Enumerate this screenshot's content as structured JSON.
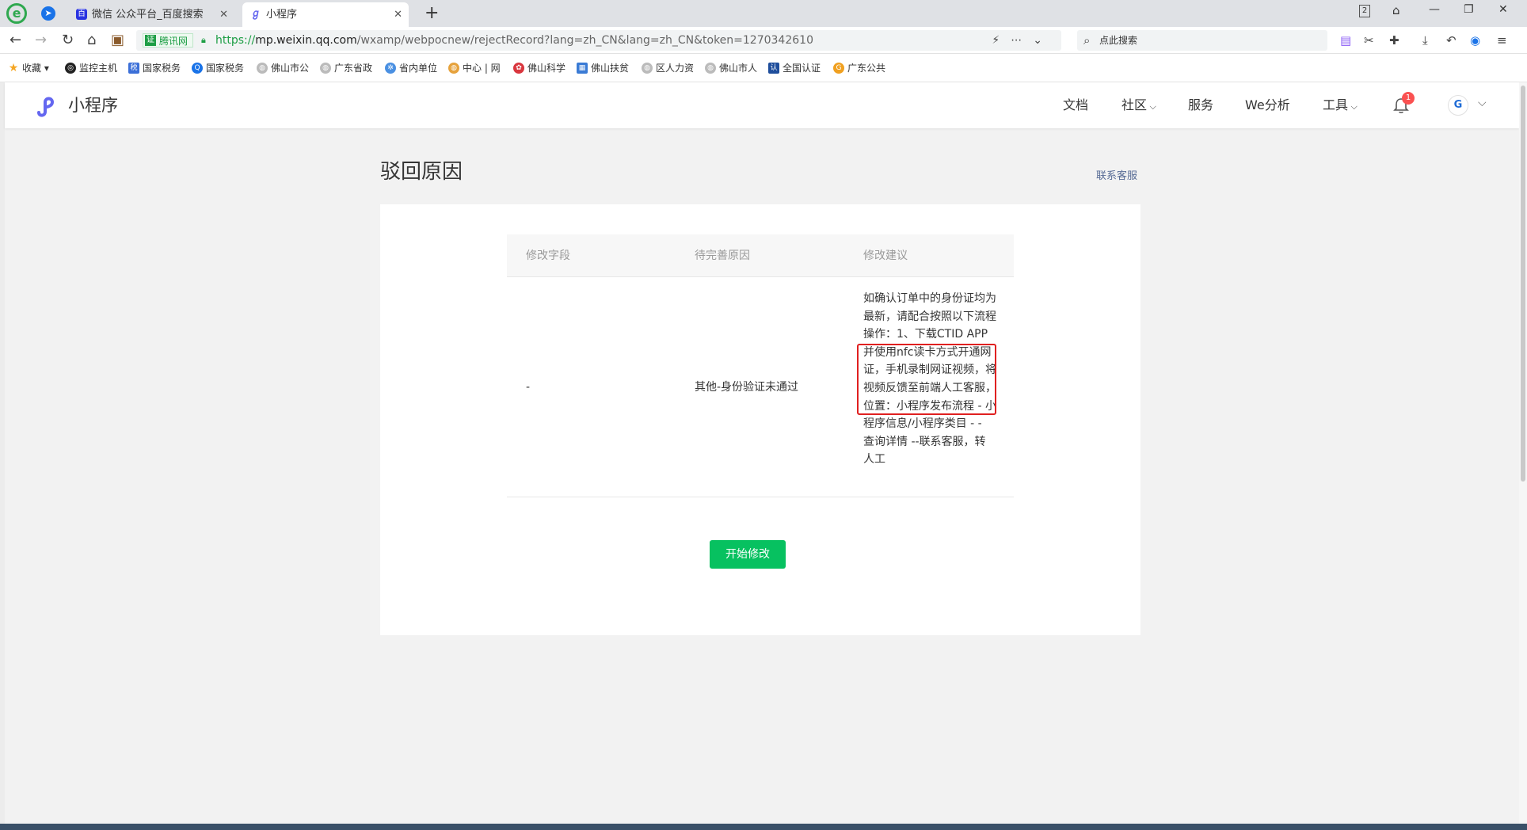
{
  "browser": {
    "tabs": [
      {
        "title": "微信 公众平台_百度搜索",
        "favicon": "baidu-paw-icon",
        "active": false
      },
      {
        "title": "小程序",
        "favicon": "miniprogram-icon",
        "active": true
      }
    ],
    "new_tab_label": "+",
    "window_badge": "2",
    "address": {
      "cert_label": "腾讯网",
      "scheme": "https://",
      "host": "mp.weixin.qq.com",
      "path": "/wxamp/webpocnew/rejectRecord?lang=zh_CN&lang=zh_CN&token=1270342610"
    },
    "search_placeholder": "点此搜索",
    "bookmarks": [
      {
        "label": "收藏",
        "icon": "star-icon"
      },
      {
        "label": "监控主机",
        "icon": "monitor-icon"
      },
      {
        "label": "国家税务",
        "icon": "tax-icon"
      },
      {
        "label": "国家税务",
        "icon": "search-icon"
      },
      {
        "label": "佛山市公",
        "icon": "globe-icon"
      },
      {
        "label": "广东省政",
        "icon": "globe-icon"
      },
      {
        "label": "省内单位",
        "icon": "gear-icon"
      },
      {
        "label": "中心 | 网",
        "icon": "globe-icon"
      },
      {
        "label": "佛山科学",
        "icon": "leaf-icon"
      },
      {
        "label": "佛山扶贫",
        "icon": "globe-icon"
      },
      {
        "label": "区人力资",
        "icon": "globe-icon"
      },
      {
        "label": "佛山市人",
        "icon": "globe-icon"
      },
      {
        "label": "全国认证",
        "icon": "cert-icon"
      },
      {
        "label": "广东公共",
        "icon": "globe-icon"
      }
    ]
  },
  "topnav": {
    "brand": "小程序",
    "items": [
      "文档",
      "社区",
      "服务",
      "We分析",
      "工具"
    ],
    "notification_count": "1"
  },
  "page": {
    "title": "驳回原因",
    "contact_link": "联系客服",
    "table": {
      "headers": [
        "修改字段",
        "待完善原因",
        "修改建议"
      ],
      "rows": [
        {
          "field": "-",
          "reason": "其他-身份验证未通过",
          "advice": "如确认订单中的身份证均为最新，请配合按照以下流程操作：1、下载CTID APP并使用nfc读卡方式开通网证，手机录制网证视频，将视频反馈至前端人工客服，位置：小程序发布流程 - 小程序信息/小程序类目 - - 查询详情 --联系客服，转人工"
        }
      ]
    },
    "start_button": "开始修改"
  },
  "colors": {
    "primary_green": "#07c160",
    "link_blue": "#576b95",
    "highlight_red": "#e02020",
    "badge_red": "#fa5151"
  }
}
